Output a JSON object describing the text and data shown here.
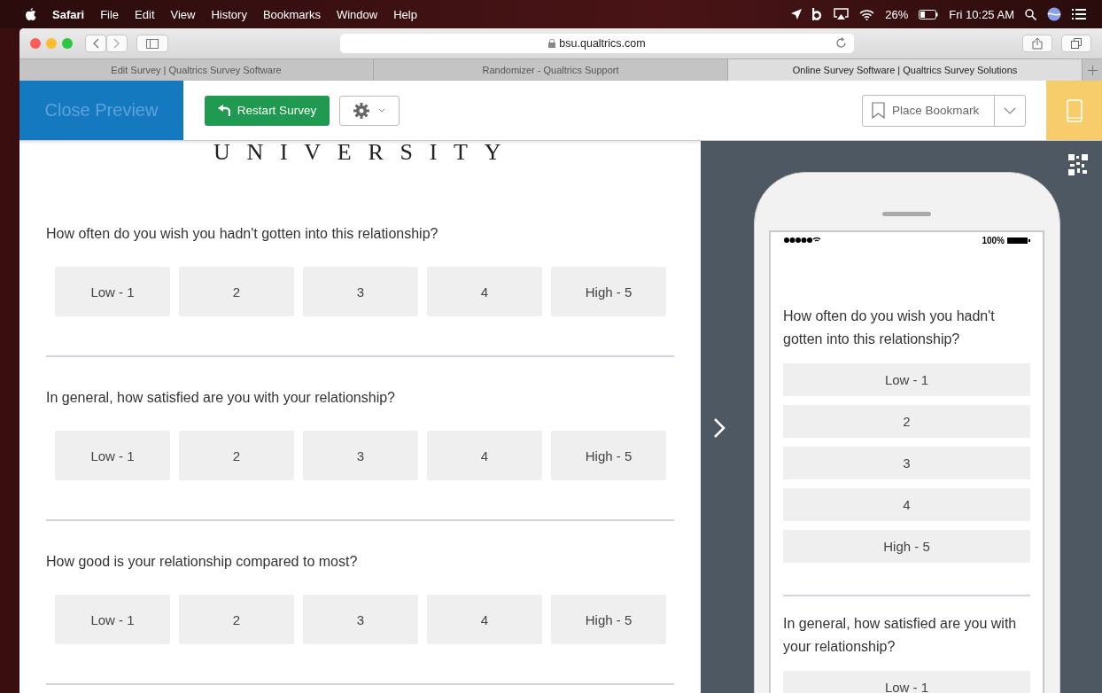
{
  "menubar": {
    "app": "Safari",
    "menus": [
      "File",
      "Edit",
      "View",
      "History",
      "Bookmarks",
      "Window",
      "Help"
    ],
    "battery": "26%",
    "clock": "Fri 10:25 AM"
  },
  "browser": {
    "url": "bsu.qualtrics.com",
    "tabs": [
      {
        "title": "Edit Survey | Qualtrics Survey Software",
        "selected": false
      },
      {
        "title": "Randomizer - Qualtrics Support",
        "selected": false
      },
      {
        "title": "Online Survey Software | Qualtrics Survey Solutions",
        "selected": true
      }
    ]
  },
  "preview_header": {
    "close": "Close Preview",
    "restart": "Restart Survey",
    "bookmark": "Place Bookmark"
  },
  "survey": {
    "logo_text": "UNIVERSITY",
    "questions": [
      {
        "text": "How often do you wish you hadn't gotten into this relationship?",
        "choices": [
          "Low - 1",
          "2",
          "3",
          "4",
          "High - 5"
        ]
      },
      {
        "text": "In general, how satisfied are you with your relationship?",
        "choices": [
          "Low - 1",
          "2",
          "3",
          "4",
          "High - 5"
        ]
      },
      {
        "text": "How good is your relationship compared to most?",
        "choices": [
          "Low - 1",
          "2",
          "3",
          "4",
          "High - 5"
        ]
      }
    ]
  },
  "mobile_preview": {
    "battery": "100%",
    "questions": [
      {
        "text": "How often do you wish you hadn't gotten into this relationship?",
        "choices": [
          "Low - 1",
          "2",
          "3",
          "4",
          "High - 5"
        ]
      },
      {
        "text": "In general, how satisfied are you with your relationship?",
        "choices": [
          "Low - 1"
        ]
      }
    ]
  }
}
